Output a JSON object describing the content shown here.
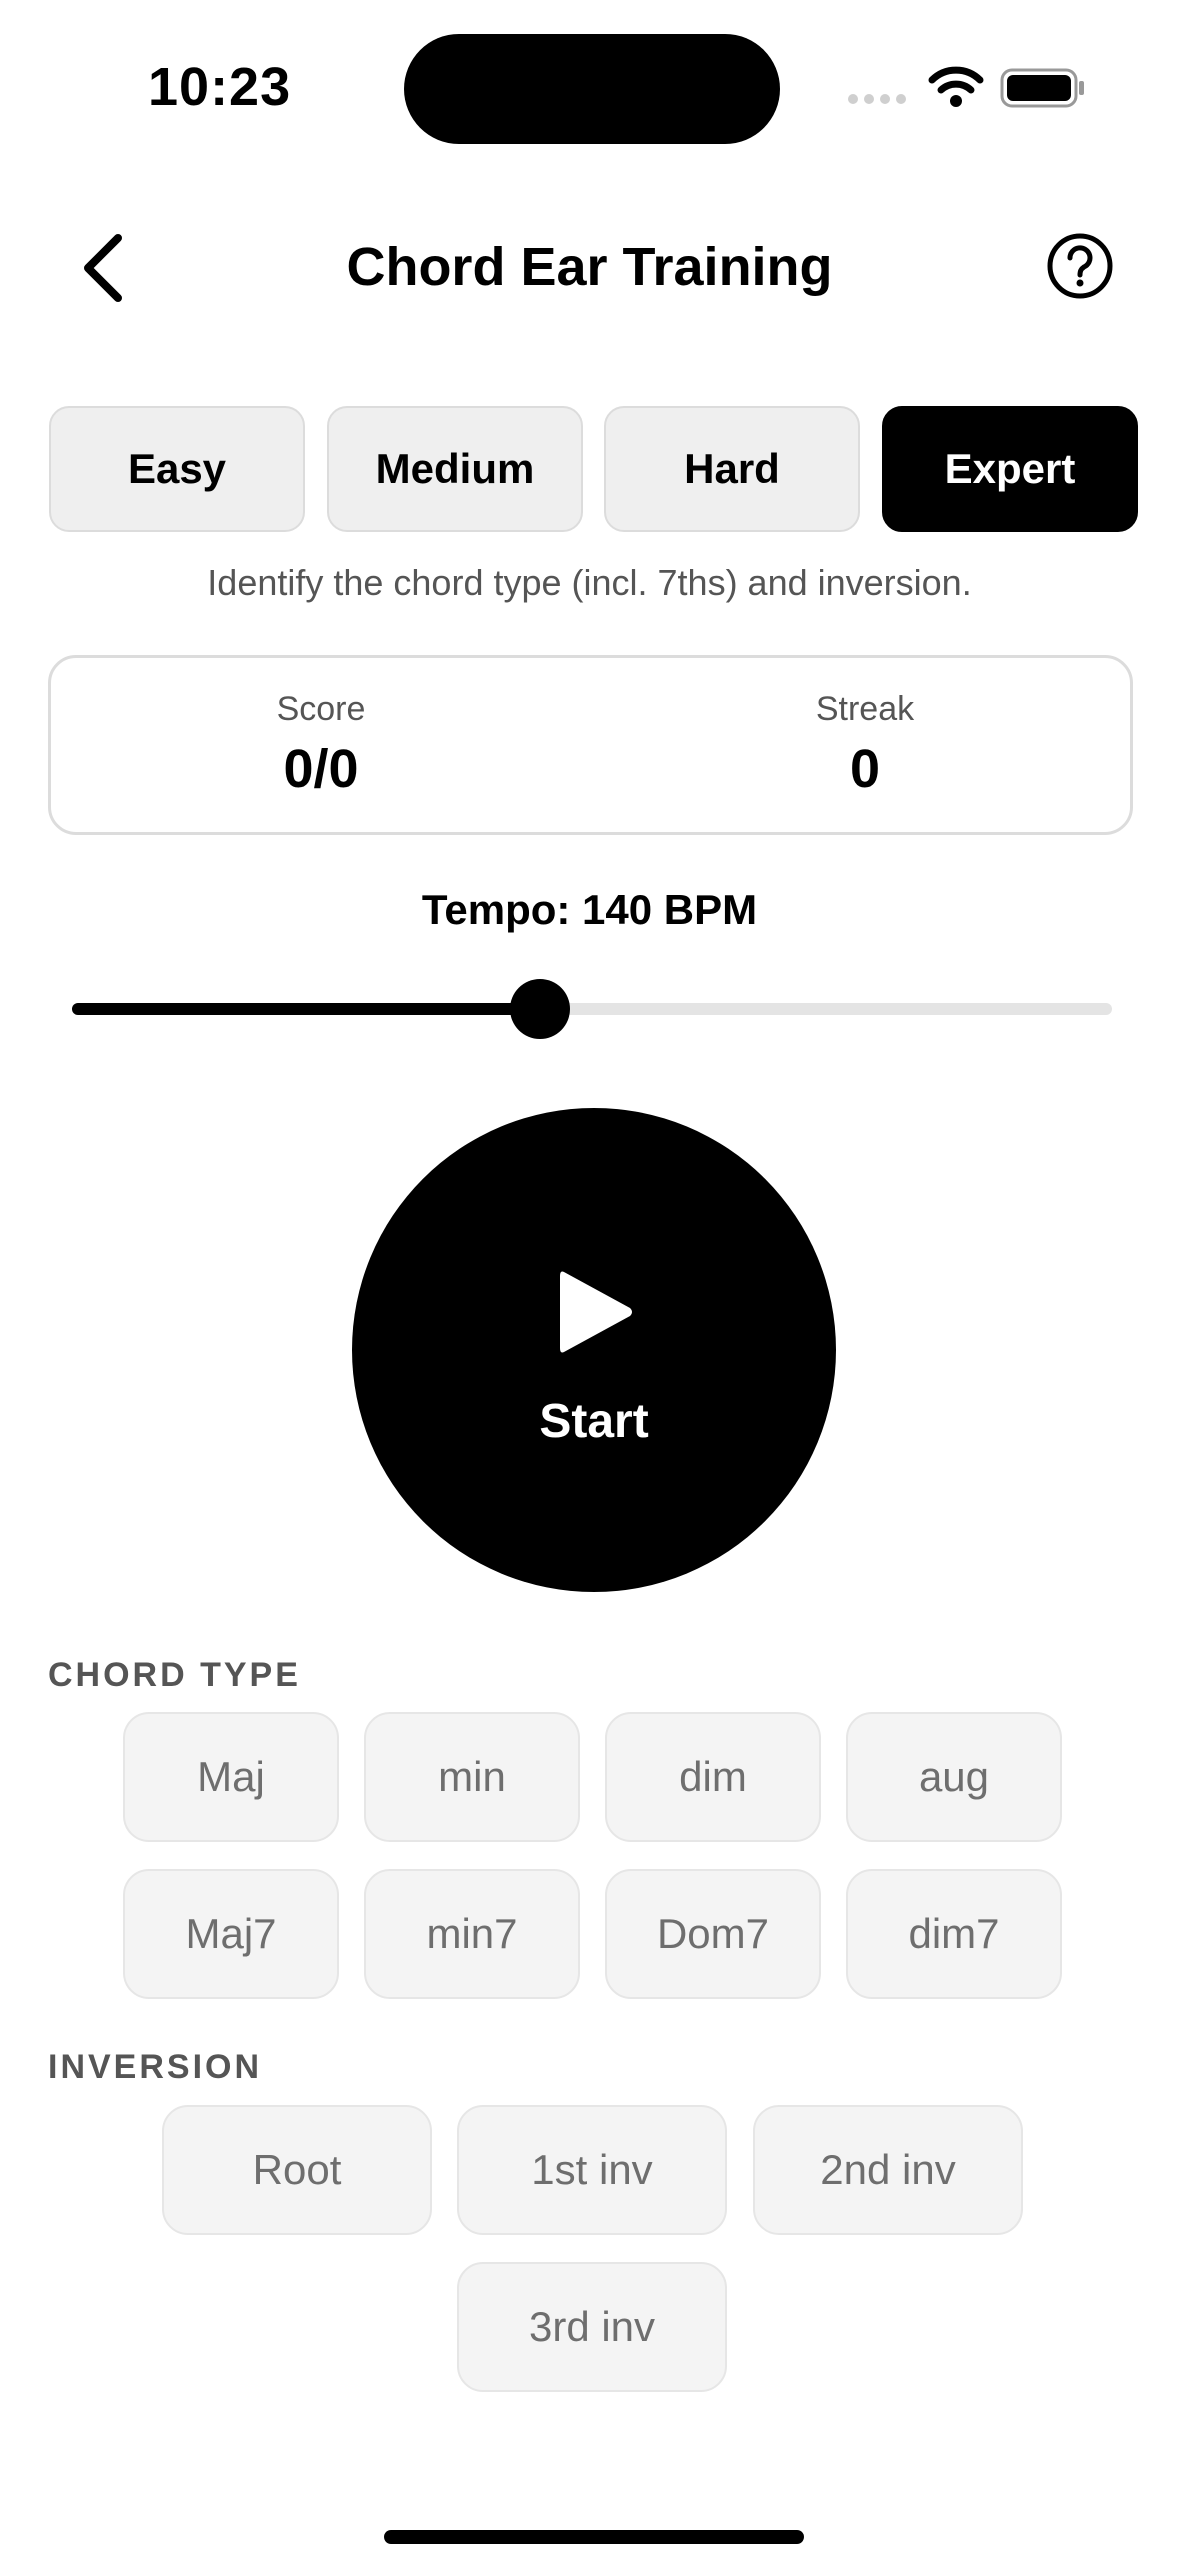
{
  "status_bar": {
    "time": "10:23"
  },
  "nav": {
    "title": "Chord Ear Training"
  },
  "difficulty": {
    "options": [
      "Easy",
      "Medium",
      "Hard",
      "Expert"
    ],
    "selected": "Expert",
    "description": "Identify the chord type (incl. 7ths) and inversion."
  },
  "stats": {
    "score_label": "Score",
    "score_value": "0/0",
    "streak_label": "Streak",
    "streak_value": "0"
  },
  "tempo": {
    "label": "Tempo: 140 BPM",
    "slider_fraction": 0.45
  },
  "start_button": {
    "label": "Start"
  },
  "chord_type": {
    "heading": "CHORD TYPE",
    "options": [
      "Maj",
      "min",
      "dim",
      "aug",
      "Maj7",
      "min7",
      "Dom7",
      "dim7"
    ]
  },
  "inversion": {
    "heading": "INVERSION",
    "options": [
      "Root",
      "1st inv",
      "2nd inv",
      "3rd inv"
    ]
  },
  "icons": {
    "back": "chevron-left-icon",
    "help": "question-circle-icon",
    "play": "play-icon",
    "wifi": "wifi-icon",
    "battery": "battery-icon",
    "signal": "cellular-signal-icon"
  },
  "colors": {
    "accent": "#000000",
    "chip_bg": "#f4f4f4",
    "chip_text": "#6e6e6e"
  }
}
